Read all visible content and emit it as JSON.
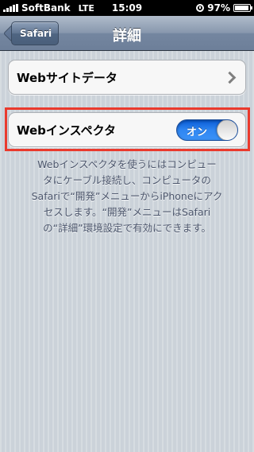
{
  "status_bar": {
    "carrier": "SoftBank",
    "network": "LTE",
    "time": "15:09",
    "battery": "97%",
    "battery_level": 0.97
  },
  "nav": {
    "back_label": "Safari",
    "title": "詳細"
  },
  "rows": {
    "web_data_label": "Webサイトデータ",
    "inspector_label": "Webインスペクタ",
    "toggle_label": "オン"
  },
  "footer": {
    "line1": "Webインスペクタを使うにはコンピュー",
    "line2": "タにケーブル接続し、コンピュータの",
    "line3": "Safariで“開発”メニューからiPhoneにアク",
    "line4": "セスします。“開発”メニューはSafari",
    "line5": "の“詳細”環境設定で有効にできます。"
  },
  "colors": {
    "highlight": "#ea3a2d",
    "toggle_on": "#2f86f2"
  }
}
